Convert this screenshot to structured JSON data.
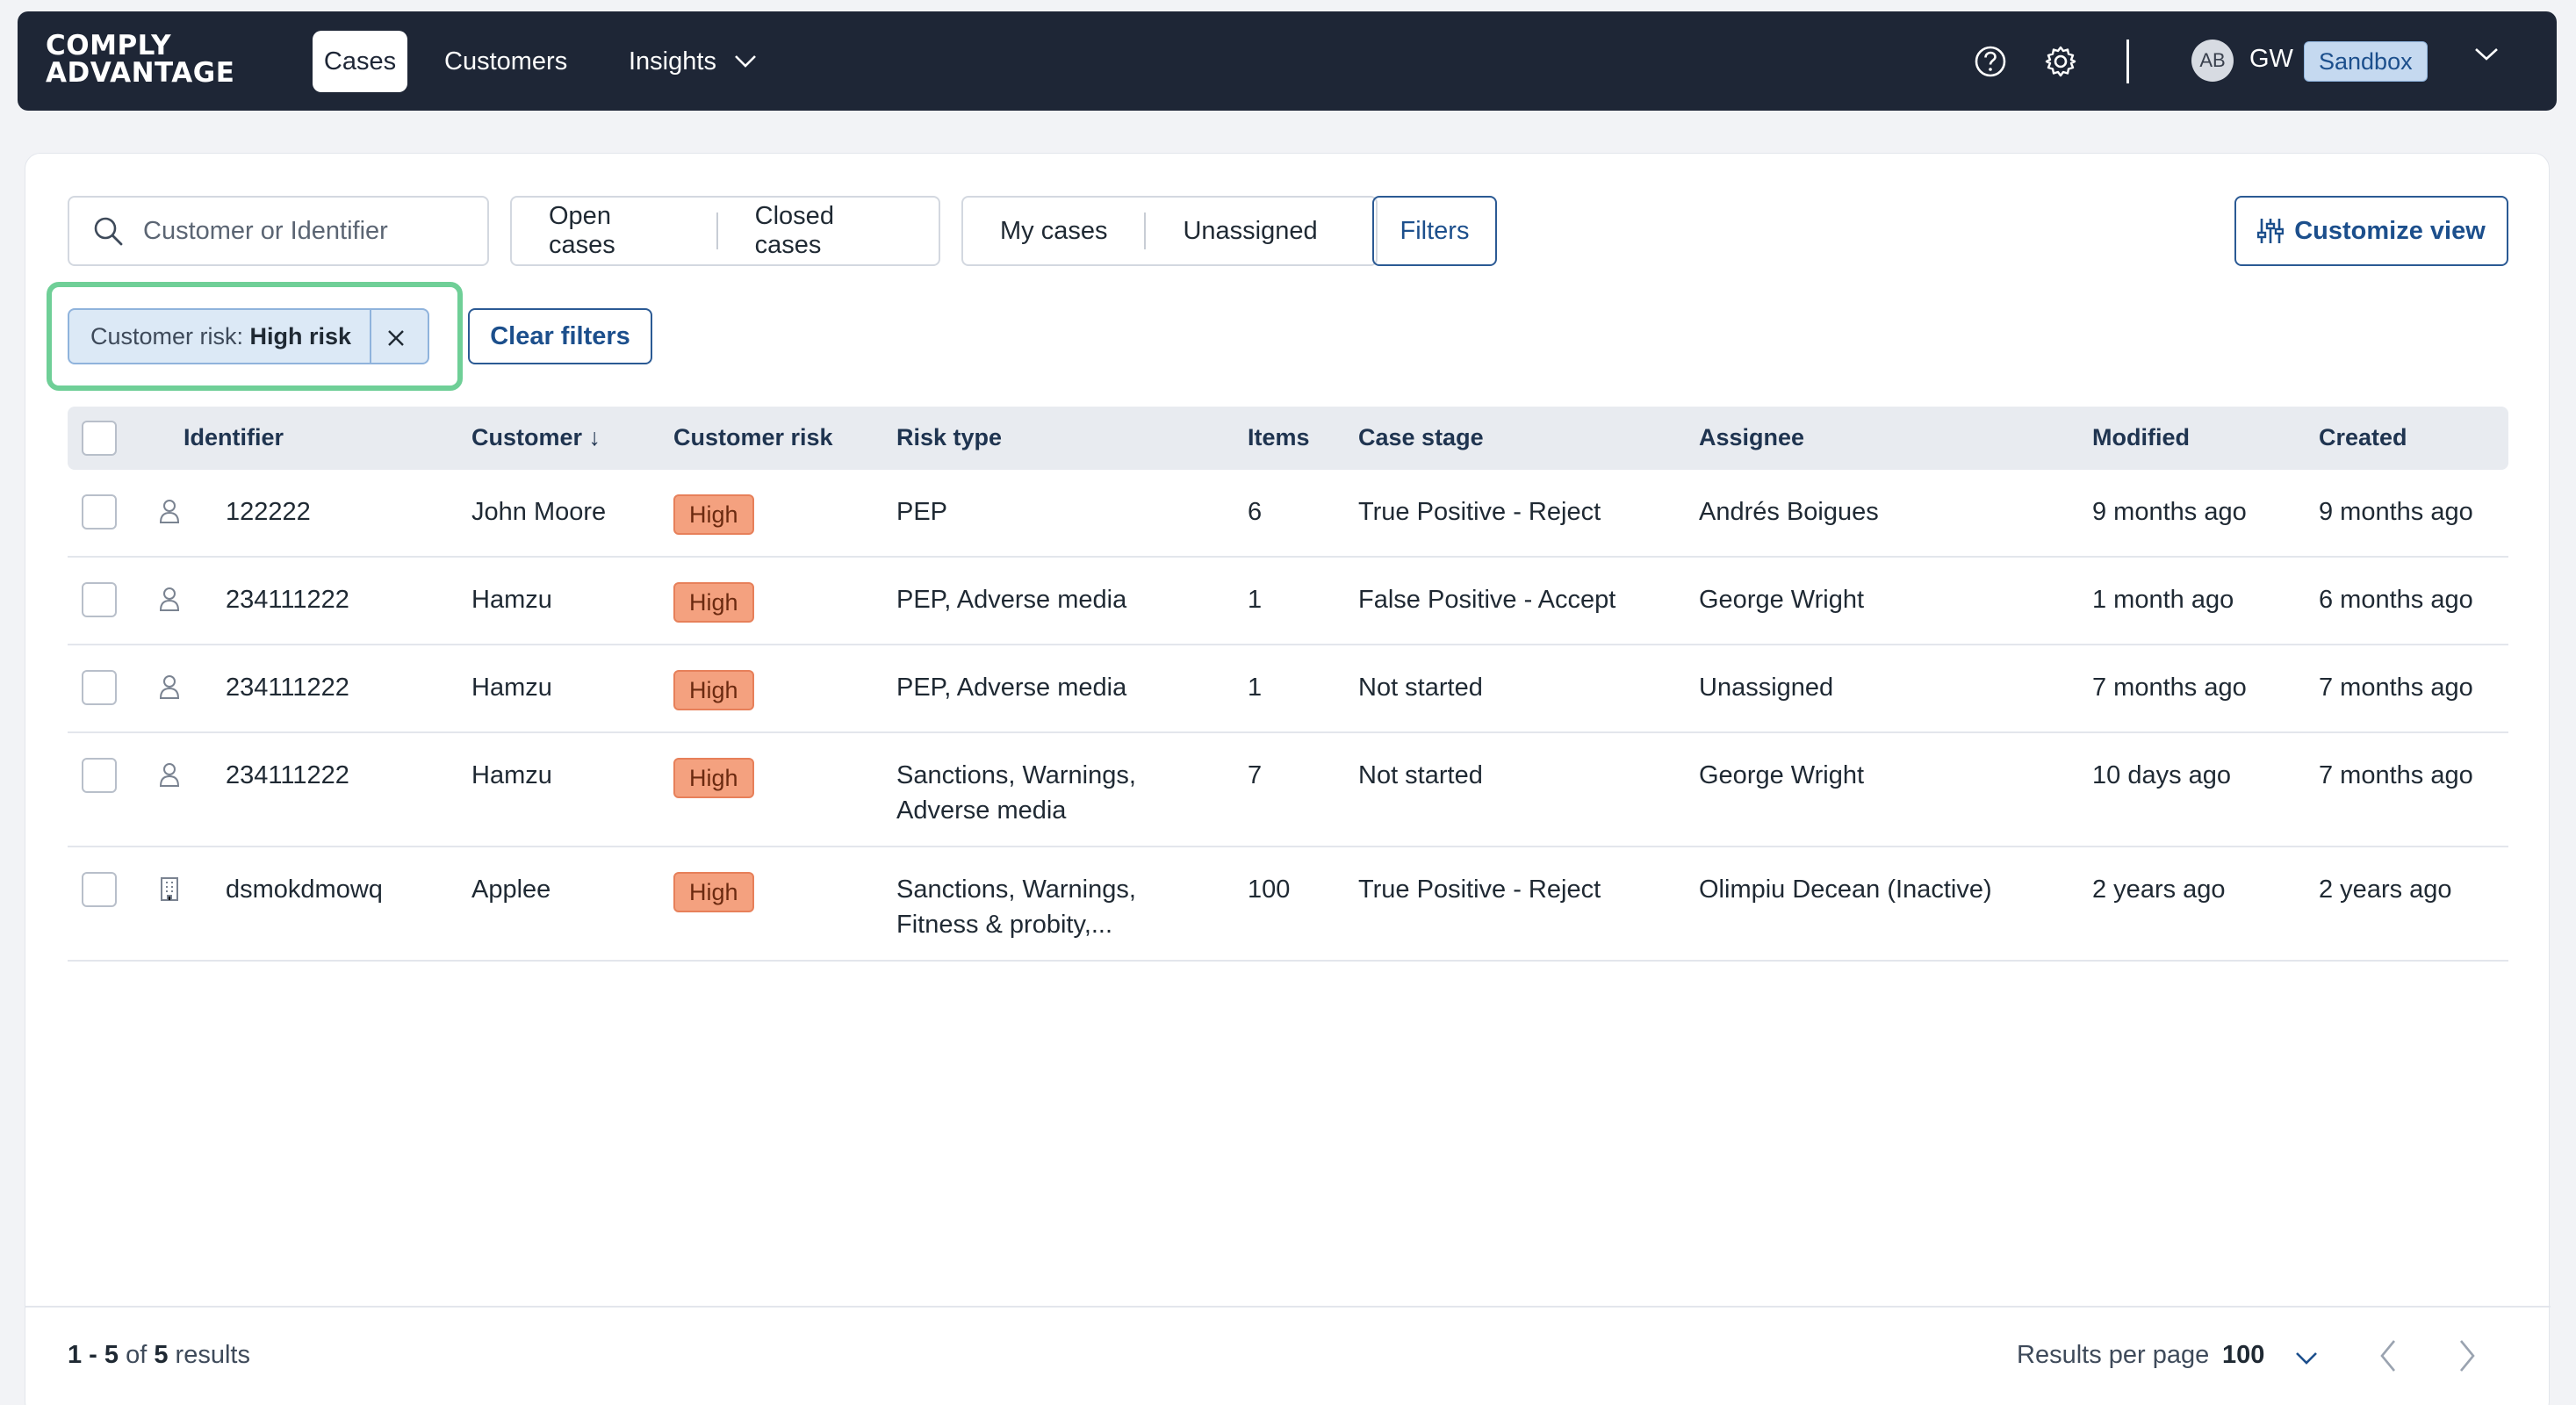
{
  "app": {
    "logo_line1": "COMPLY",
    "logo_line2": "ADVANTAGE"
  },
  "nav": {
    "tabs": [
      {
        "label": "Cases",
        "active": true
      },
      {
        "label": "Customers",
        "active": false
      },
      {
        "label": "Insights",
        "active": false
      }
    ],
    "user": {
      "avatar_initials": "AB",
      "initials": "GW",
      "environment": "Sandbox"
    }
  },
  "toolbar": {
    "search_placeholder": "Customer or Identifier",
    "status_segment": [
      "Open cases",
      "Closed cases"
    ],
    "assignment_segment": [
      "My cases",
      "Unassigned"
    ],
    "filters_label": "Filters",
    "customize_label": "Customize view"
  },
  "active_filters": {
    "chip_key": "Customer risk: ",
    "chip_value": "High risk",
    "clear_label": "Clear filters"
  },
  "table": {
    "columns": [
      "Identifier",
      "Customer ↓",
      "Customer risk",
      "Risk type",
      "Items",
      "Case stage",
      "Assignee",
      "Modified",
      "Created"
    ],
    "rows": [
      {
        "entity": "person",
        "identifier": "122222",
        "customer": "John Moore",
        "risk": "High",
        "risk_type_1": "PEP",
        "risk_type_2": "",
        "items": "6",
        "stage": "True Positive - Reject",
        "assignee": "Andrés Boigues",
        "modified": "9 months ago",
        "created": "9 months ago"
      },
      {
        "entity": "person",
        "identifier": "234111222",
        "customer": "Hamzu",
        "risk": "High",
        "risk_type_1": "PEP, Adverse media",
        "risk_type_2": "",
        "items": "1",
        "stage": "False Positive - Accept",
        "assignee": "George Wright",
        "modified": "1 month ago",
        "created": "6 months ago"
      },
      {
        "entity": "person",
        "identifier": "234111222",
        "customer": "Hamzu",
        "risk": "High",
        "risk_type_1": "PEP, Adverse media",
        "risk_type_2": "",
        "items": "1",
        "stage": "Not started",
        "assignee": "Unassigned",
        "modified": "7 months ago",
        "created": "7 months ago"
      },
      {
        "entity": "person",
        "identifier": "234111222",
        "customer": "Hamzu",
        "risk": "High",
        "risk_type_1": "Sanctions, Warnings,",
        "risk_type_2": "Adverse media",
        "items": "7",
        "stage": "Not started",
        "assignee": "George Wright",
        "modified": "10 days ago",
        "created": "7 months ago"
      },
      {
        "entity": "company",
        "identifier": "dsmokdmowq",
        "customer": "Applee",
        "risk": "High",
        "risk_type_1": "Sanctions, Warnings,",
        "risk_type_2": "Fitness & probity,...",
        "items": "100",
        "stage": "True Positive - Reject",
        "assignee": "Olimpiu Decean (Inactive)",
        "modified": "2 years ago",
        "created": "2 years ago"
      }
    ]
  },
  "footer": {
    "range": "1 - 5",
    "of": " of ",
    "total": "5",
    "results_word": " results",
    "rpp_label": "Results per page",
    "rpp_value": "100"
  },
  "colors": {
    "nav_bg": "#1e2636",
    "accent": "#1c4f8c",
    "high_risk_badge": "#f4a17f",
    "highlight": "#6fcf97"
  }
}
